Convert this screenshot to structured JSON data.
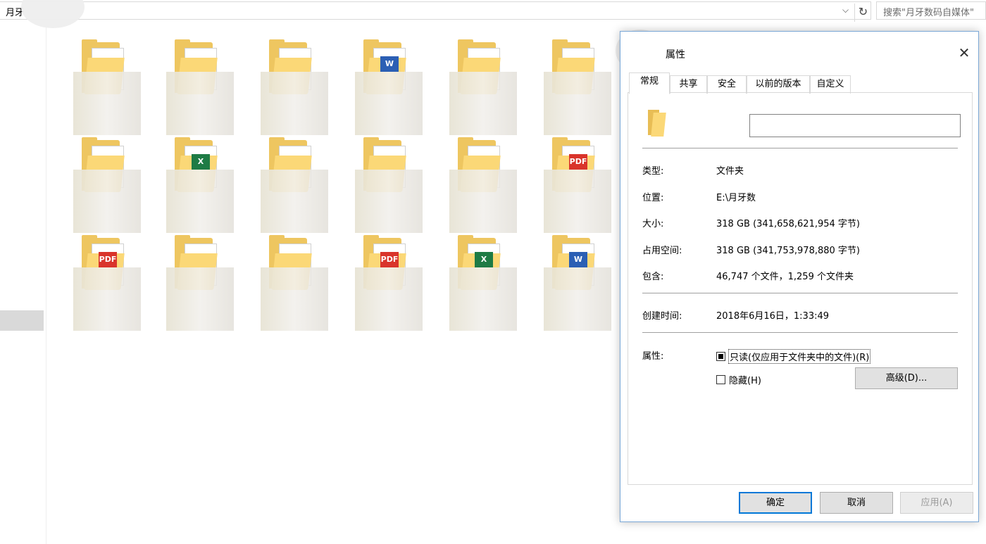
{
  "explorer": {
    "address_text": "月牙",
    "address_dropdown_icon": "chevron-down-icon",
    "refresh_icon": "refresh-icon",
    "search_placeholder": "搜索\"月牙数码自媒体\""
  },
  "folder_tiles": [
    {
      "badge": ""
    },
    {
      "badge": ""
    },
    {
      "badge": ""
    },
    {
      "badge": "W"
    },
    {
      "badge": ""
    },
    {
      "badge": ""
    },
    {
      "badge": ""
    },
    {
      "badge": "X"
    },
    {
      "badge": ""
    },
    {
      "badge": ""
    },
    {
      "badge": ""
    },
    {
      "badge": "PDF"
    },
    {
      "badge": "PDF"
    },
    {
      "badge": ""
    },
    {
      "badge": ""
    },
    {
      "badge": "PDF"
    },
    {
      "badge": "X"
    },
    {
      "badge": "W"
    }
  ],
  "dialog": {
    "title": "属性",
    "close_label": "✕",
    "tabs": [
      "常规",
      "共享",
      "安全",
      "以前的版本",
      "自定义"
    ],
    "name_value": "",
    "fields": {
      "type_label": "类型:",
      "type_value": "文件夹",
      "location_label": "位置:",
      "location_value": "E:\\月牙数",
      "size_label": "大小:",
      "size_value": "318 GB (341,658,621,954 字节)",
      "disk_label": "占用空间:",
      "disk_value": "318 GB (341,753,978,880 字节)",
      "contains_label": "包含:",
      "contains_value": "46,747 个文件，1,259 个文件夹",
      "created_label": "创建时间:",
      "created_value": "2018年6月16日，1:33:49",
      "attr_label": "属性:"
    },
    "readonly_label": "只读(仅应用于文件夹中的文件)(R)",
    "hidden_label": "隐藏(H)",
    "advanced_label": "高级(D)...",
    "ok_label": "确定",
    "cancel_label": "取消",
    "apply_label": "应用(A)"
  }
}
